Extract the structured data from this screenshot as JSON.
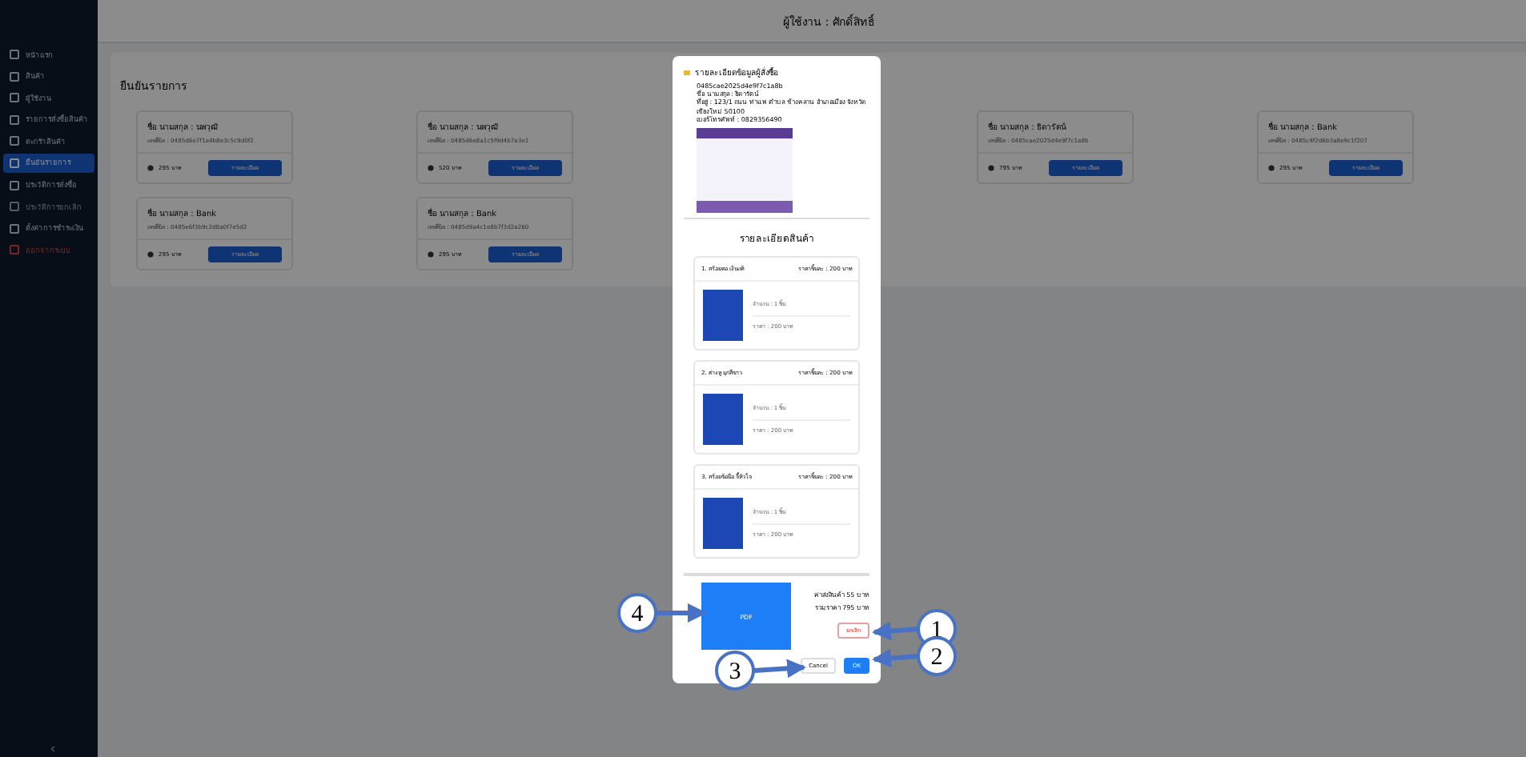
{
  "sidebar": {
    "items": [
      {
        "label": "หน้าแรก",
        "kind": "link",
        "selected": false
      },
      {
        "label": "สินค้า",
        "kind": "link",
        "selected": false
      },
      {
        "label": "ผู้ใช้งาน",
        "kind": "link",
        "selected": false
      },
      {
        "label": "รายการสั่งซื้อสินค้า",
        "kind": "link",
        "selected": false
      },
      {
        "label": "ตะกร้าสินค้า",
        "kind": "link",
        "selected": false
      },
      {
        "label": "ยืนยันรายการ",
        "kind": "link",
        "selected": true
      },
      {
        "label": "ประวัติการสั่งซื้อ",
        "kind": "link",
        "selected": false
      },
      {
        "label": "ประวัติการยกเลิก",
        "kind": "section",
        "selected": false
      },
      {
        "label": "ตั้งค่าการชำระเงิน",
        "kind": "link",
        "selected": false
      },
      {
        "label": "ออกจากระบบ",
        "kind": "danger",
        "selected": false
      }
    ]
  },
  "header": {
    "user": "ผู้ใช้งาน : ศักดิ์สิทธิ์"
  },
  "panel": {
    "title": "ยืนยันรายการ",
    "rows": [
      [
        {
          "name": "ชื่อ นามสกุล : นพวุฒิ",
          "bill": "เลขที่บิล : 0485d6e7f1a4b8e3c5c9d0f2",
          "price": "295 บาท",
          "button": "รายละเอียด"
        },
        {
          "name": "ชื่อ นามสกุล : นพวุฒิ",
          "bill": "เลขที่บิล : 0485d6e8a1c5f9d4b7a3e1",
          "price": "520 บาท",
          "button": "รายละเอียด"
        },
        null,
        {
          "name": "ชื่อ นามสกุล : ธิดารัตน์",
          "bill": "เลขที่บิล : 0485cae2025d4e9f7c1a8b",
          "price": "795 บาท",
          "button": "รายละเอียด"
        },
        {
          "name": "ชื่อ นามสกุล : Bank",
          "bill": "เลขที่บิล : 0485c4f2d6b3a8e9c1f207",
          "price": "295 บาท",
          "button": "รายละเอียด"
        }
      ],
      [
        {
          "name": "ชื่อ นามสกุล : Bank",
          "bill": "เลขที่บิล : 0485e6f3b9c2d8a0f7e5d2",
          "price": "295 บาท",
          "button": "รายละเอียด"
        },
        {
          "name": "ชื่อ นามสกุล : Bank",
          "bill": "เลขที่บิล : 0485d9a4c1e8b7f3d2a260",
          "price": "295 บาท",
          "button": "รายละเอียด"
        }
      ]
    ]
  },
  "modal": {
    "title": "รายละเอียดข้อมูลผู้สั่งซื้อ",
    "info": [
      "0485cae2025d4e9f7c1a8b",
      "ชื่อ นามสกุล : ธิดารัตน์",
      "ที่อยู่ : 123/1 ถนน ท่าแพ ตำบล ช้างคลาน อำเภอเมือง จังหวัดเชียงใหม่ 50100",
      "เบอร์โทรศัพท์ : 0829356490"
    ],
    "products_title": "รายละเอียดสินค้า",
    "products": [
      {
        "name": "1. สร้อยคอ เงินแท้",
        "unit_price": "ราคาชิ้นละ : 200 บาท",
        "qty": "จำนวน : 1 ชิ้น",
        "total": "ราคา : 200 บาท"
      },
      {
        "name": "2. ต่างหู มุกสีขาว",
        "unit_price": "ราคาชิ้นละ : 200 บาท",
        "qty": "จำนวน : 1 ชิ้น",
        "total": "ราคา : 200 บาท"
      },
      {
        "name": "3. สร้อยข้อมือ จี้หัวใจ",
        "unit_price": "ราคาชิ้นละ : 200 บาท",
        "qty": "จำนวน : 1 ชิ้น",
        "total": "ราคา : 200 บาท"
      }
    ],
    "pdf": "PDF",
    "shipping": "ค่าส่งสินค้า 55 บาท",
    "sum": "รวมราคา 795 บาท",
    "reject": "ยกเลิก",
    "cancel": "Cancel",
    "ok": "OK"
  },
  "annotations": [
    "1",
    "2",
    "3",
    "4"
  ]
}
